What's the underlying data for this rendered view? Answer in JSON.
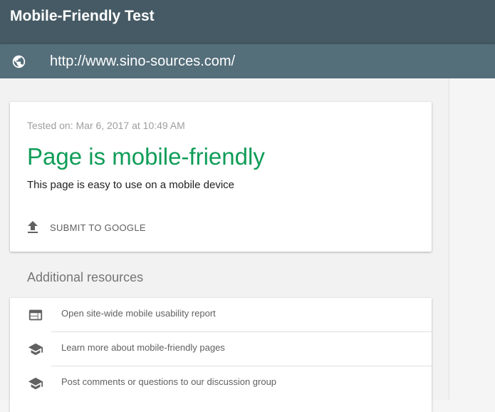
{
  "header": {
    "title": "Mobile-Friendly Test",
    "url": "http://www.sino-sources.com/",
    "url_icon": "globe-icon"
  },
  "result": {
    "tested_on": "Tested on: Mar 6, 2017 at 10:49 AM",
    "verdict": "Page is mobile-friendly",
    "description": "This page is easy to use on a mobile device",
    "submit_label": "SUBMIT TO GOOGLE",
    "submit_icon": "upload-icon"
  },
  "resources": {
    "heading": "Additional resources",
    "items": [
      {
        "label": "Open site-wide mobile usability report",
        "icon": "web-layout-icon"
      },
      {
        "label": "Learn more about mobile-friendly pages",
        "icon": "graduation-cap-icon"
      },
      {
        "label": "Post comments or questions to our discussion group",
        "icon": "graduation-cap-icon"
      }
    ]
  },
  "colors": {
    "header_bg": "#455a64",
    "urlbar_bg": "#546e7a",
    "success_green": "#0f9d58"
  }
}
